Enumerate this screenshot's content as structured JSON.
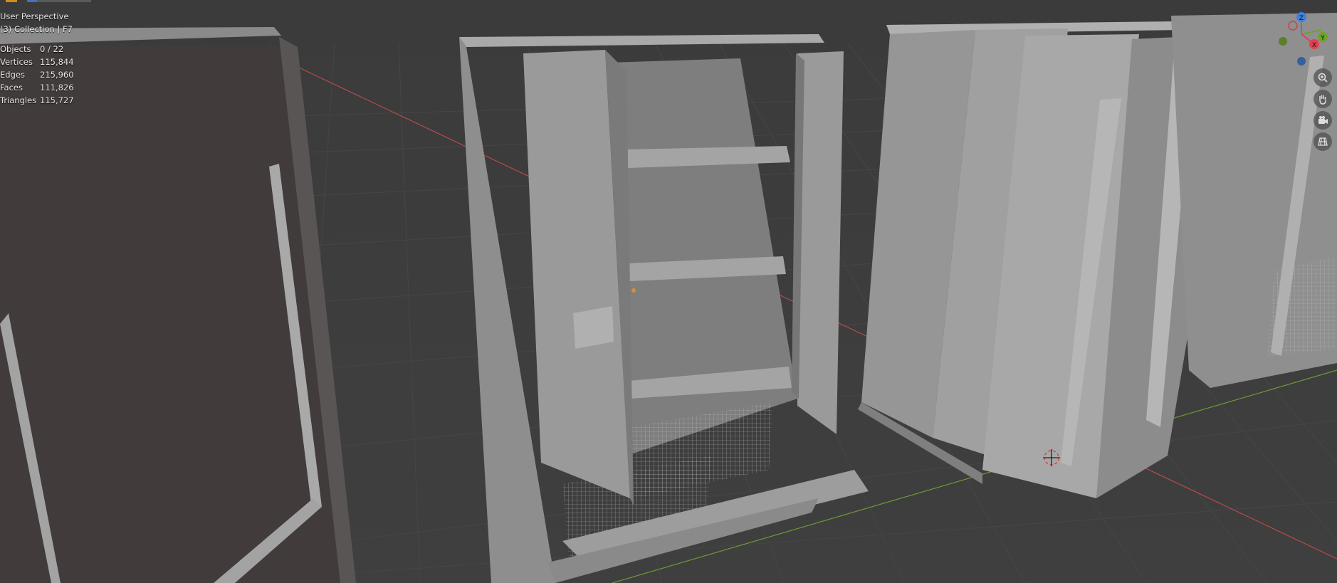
{
  "viewport": {
    "view_name": "User Perspective",
    "collection_label": "(3) Collection | F7",
    "stats": [
      {
        "label": "Objects",
        "value": "0 / 22"
      },
      {
        "label": "Vertices",
        "value": "115,844"
      },
      {
        "label": "Edges",
        "value": "215,960"
      },
      {
        "label": "Faces",
        "value": "111,826"
      },
      {
        "label": "Triangles",
        "value": "115,727"
      }
    ]
  },
  "gizmo": {
    "z_label": "Z",
    "y_label": "Y",
    "x_label": "X",
    "colors": {
      "x": "#e04050",
      "y": "#6ea32b",
      "z": "#3f7fe0"
    }
  },
  "tools": [
    {
      "name": "zoom-icon"
    },
    {
      "name": "hand-pan-icon"
    },
    {
      "name": "camera-icon"
    },
    {
      "name": "grid-view-icon"
    }
  ],
  "colors": {
    "background": "#3d3d3d",
    "grid": "#474747",
    "x_axis": "#b94a4a",
    "y_axis": "#6d9a35",
    "model": "#8f8f8f"
  }
}
